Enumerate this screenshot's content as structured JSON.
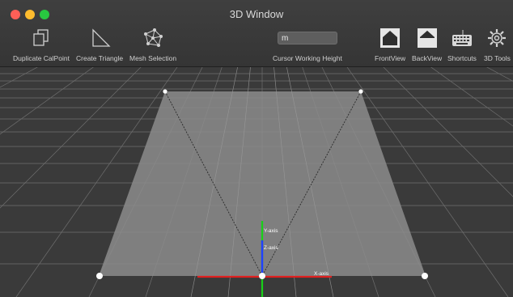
{
  "window": {
    "title": "3D Window"
  },
  "toolbar": {
    "duplicate_calpoint": "Duplicate CalPoint",
    "create_triangle": "Create Triangle",
    "mesh_selection": "Mesh Selection",
    "cursor_height_value": "m",
    "cursor_height_label": "Cursor Working Height",
    "front_view": "FrontView",
    "back_view": "BackView",
    "shortcuts": "Shortcuts",
    "tools_3d": "3D Tools"
  },
  "viewport": {
    "y_axis_label": "Y-axis",
    "z_axis_label": "Z-axis",
    "x_axis_label": "X-axis",
    "colors": {
      "x_axis": "#e02020",
      "y_axis": "#18d018",
      "z_axis": "#2040ff",
      "plane": "#8a8a8a",
      "grid": "#9a9a9a"
    }
  }
}
